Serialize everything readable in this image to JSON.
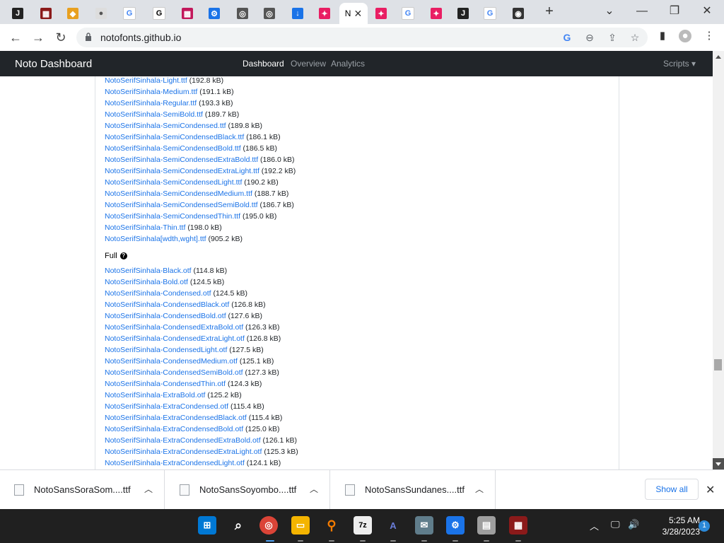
{
  "browser": {
    "active_tab_title": "N",
    "url": "notofonts.github.io"
  },
  "navbar": {
    "brand": "Noto Dashboard",
    "links": [
      "Dashboard",
      "Overview",
      "Analytics"
    ],
    "scripts": "Scripts ▾"
  },
  "files_upper": [
    {
      "name": "NotoSerifSinhala-Light.ttf",
      "size": "(192.8 kB)"
    },
    {
      "name": "NotoSerifSinhala-Medium.ttf",
      "size": "(191.1 kB)"
    },
    {
      "name": "NotoSerifSinhala-Regular.ttf",
      "size": "(193.3 kB)"
    },
    {
      "name": "NotoSerifSinhala-SemiBold.ttf",
      "size": "(189.7 kB)"
    },
    {
      "name": "NotoSerifSinhala-SemiCondensed.ttf",
      "size": "(189.8 kB)"
    },
    {
      "name": "NotoSerifSinhala-SemiCondensedBlack.ttf",
      "size": "(186.1 kB)"
    },
    {
      "name": "NotoSerifSinhala-SemiCondensedBold.ttf",
      "size": "(186.5 kB)"
    },
    {
      "name": "NotoSerifSinhala-SemiCondensedExtraBold.ttf",
      "size": "(186.0 kB)"
    },
    {
      "name": "NotoSerifSinhala-SemiCondensedExtraLight.ttf",
      "size": "(192.2 kB)"
    },
    {
      "name": "NotoSerifSinhala-SemiCondensedLight.ttf",
      "size": "(190.2 kB)"
    },
    {
      "name": "NotoSerifSinhala-SemiCondensedMedium.ttf",
      "size": "(188.7 kB)"
    },
    {
      "name": "NotoSerifSinhala-SemiCondensedSemiBold.ttf",
      "size": "(186.7 kB)"
    },
    {
      "name": "NotoSerifSinhala-SemiCondensedThin.ttf",
      "size": "(195.0 kB)"
    },
    {
      "name": "NotoSerifSinhala-Thin.ttf",
      "size": "(198.0 kB)"
    },
    {
      "name": "NotoSerifSinhala[wdth,wght].ttf",
      "size": "(905.2 kB)"
    }
  ],
  "full_heading": "Full",
  "files_full": [
    {
      "name": "NotoSerifSinhala-Black.otf",
      "size": "(114.8 kB)"
    },
    {
      "name": "NotoSerifSinhala-Bold.otf",
      "size": "(124.5 kB)"
    },
    {
      "name": "NotoSerifSinhala-Condensed.otf",
      "size": "(124.5 kB)"
    },
    {
      "name": "NotoSerifSinhala-CondensedBlack.otf",
      "size": "(126.8 kB)"
    },
    {
      "name": "NotoSerifSinhala-CondensedBold.otf",
      "size": "(127.6 kB)"
    },
    {
      "name": "NotoSerifSinhala-CondensedExtraBold.otf",
      "size": "(126.3 kB)"
    },
    {
      "name": "NotoSerifSinhala-CondensedExtraLight.otf",
      "size": "(126.8 kB)"
    },
    {
      "name": "NotoSerifSinhala-CondensedLight.otf",
      "size": "(127.5 kB)"
    },
    {
      "name": "NotoSerifSinhala-CondensedMedium.otf",
      "size": "(125.1 kB)"
    },
    {
      "name": "NotoSerifSinhala-CondensedSemiBold.otf",
      "size": "(127.3 kB)"
    },
    {
      "name": "NotoSerifSinhala-CondensedThin.otf",
      "size": "(124.3 kB)"
    },
    {
      "name": "NotoSerifSinhala-ExtraBold.otf",
      "size": "(125.2 kB)"
    },
    {
      "name": "NotoSerifSinhala-ExtraCondensed.otf",
      "size": "(115.4 kB)"
    },
    {
      "name": "NotoSerifSinhala-ExtraCondensedBlack.otf",
      "size": "(115.4 kB)"
    },
    {
      "name": "NotoSerifSinhala-ExtraCondensedBold.otf",
      "size": "(125.0 kB)"
    },
    {
      "name": "NotoSerifSinhala-ExtraCondensedExtraBold.otf",
      "size": "(126.1 kB)"
    },
    {
      "name": "NotoSerifSinhala-ExtraCondensedExtraLight.otf",
      "size": "(125.3 kB)"
    },
    {
      "name": "NotoSerifSinhala-ExtraCondensedLight.otf",
      "size": "(124.1 kB)"
    }
  ],
  "downloads": [
    {
      "name": "NotoSansSoraSom....ttf"
    },
    {
      "name": "NotoSansSoyombo....ttf"
    },
    {
      "name": "NotoSansSundanes....ttf"
    }
  ],
  "download_bar": {
    "show_all": "Show all"
  },
  "taskbar": {
    "time": "5:25 AM",
    "date": "3/28/2023",
    "notifications": "1"
  },
  "colors": {
    "link": "#1a73e8",
    "navbar": "#212529",
    "taskbar": "#202020"
  }
}
